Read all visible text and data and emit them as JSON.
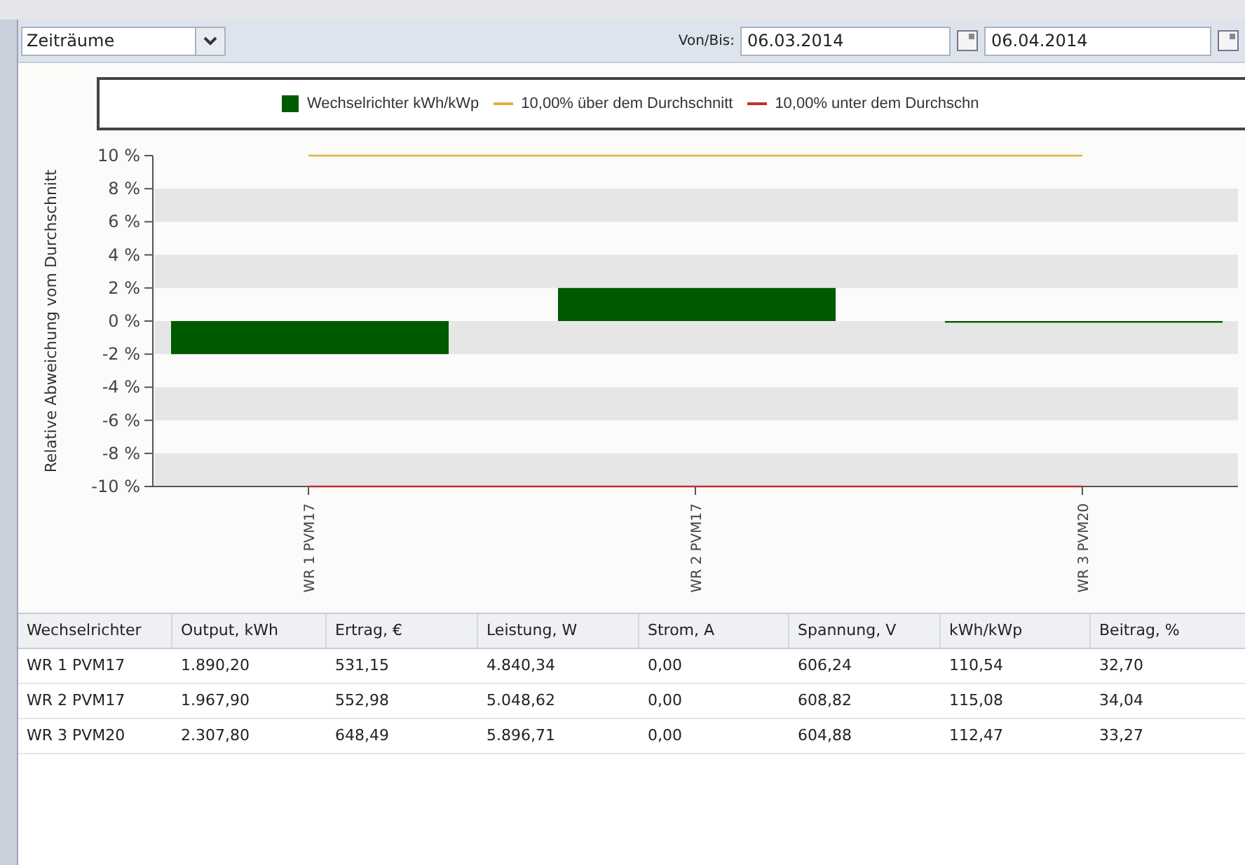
{
  "toolbar": {
    "period": {
      "value": "Zeiträume"
    },
    "range_label": "Von/Bis:",
    "from": {
      "value": "06.03.2014"
    },
    "to": {
      "value": "06.04.2014"
    }
  },
  "chart": {
    "chart_data": {
      "type": "bar",
      "ylabel": "Relative Abweichung vom Durchschnitt",
      "categories": [
        "WR 1 PVM17",
        "WR 2 PVM17",
        "WR 3 PVM20"
      ],
      "series": [
        {
          "name": "Wechselrichter kWh/kWp",
          "color": "#005a00",
          "values": [
            -2,
            2,
            -0.1
          ]
        },
        {
          "name": "10,00% über dem Durchschnitt",
          "type": "line",
          "color": "#e0b040",
          "values": [
            10,
            10,
            10
          ]
        },
        {
          "name": "10,00% unter dem Durchschn",
          "type": "line",
          "color": "#c03030",
          "values": [
            -10,
            -10,
            -10
          ]
        }
      ],
      "legend": "top",
      "ylim": [
        -10,
        10
      ],
      "yticks": [
        {
          "value": 10,
          "label": "10 %"
        },
        {
          "value": 8,
          "label": "8 %"
        },
        {
          "value": 6,
          "label": "6 %"
        },
        {
          "value": 4,
          "label": "4 %"
        },
        {
          "value": 2,
          "label": "2 %"
        },
        {
          "value": 0,
          "label": "0 %"
        },
        {
          "value": -2,
          "label": "-2 %"
        },
        {
          "value": -4,
          "label": "-4 %"
        },
        {
          "value": -6,
          "label": "-6 %"
        },
        {
          "value": -8,
          "label": "-8 %"
        },
        {
          "value": -10,
          "label": "-10 %"
        }
      ]
    }
  },
  "table": {
    "columns": [
      "Wechselrichter",
      "Output, kWh",
      "Ertrag, €",
      "Leistung, W",
      "Strom, A",
      "Spannung, V",
      "kWh/kWp",
      "Beitrag, %"
    ],
    "rows": [
      [
        "WR 1 PVM17",
        "1.890,20",
        "531,15",
        "4.840,34",
        "0,00",
        "606,24",
        "110,54",
        "32,70"
      ],
      [
        "WR 2 PVM17",
        "1.967,90",
        "552,98",
        "5.048,62",
        "0,00",
        "608,82",
        "115,08",
        "34,04"
      ],
      [
        "WR 3 PVM20",
        "2.307,80",
        "648,49",
        "5.896,71",
        "0,00",
        "604,88",
        "112,47",
        "33,27"
      ]
    ]
  }
}
